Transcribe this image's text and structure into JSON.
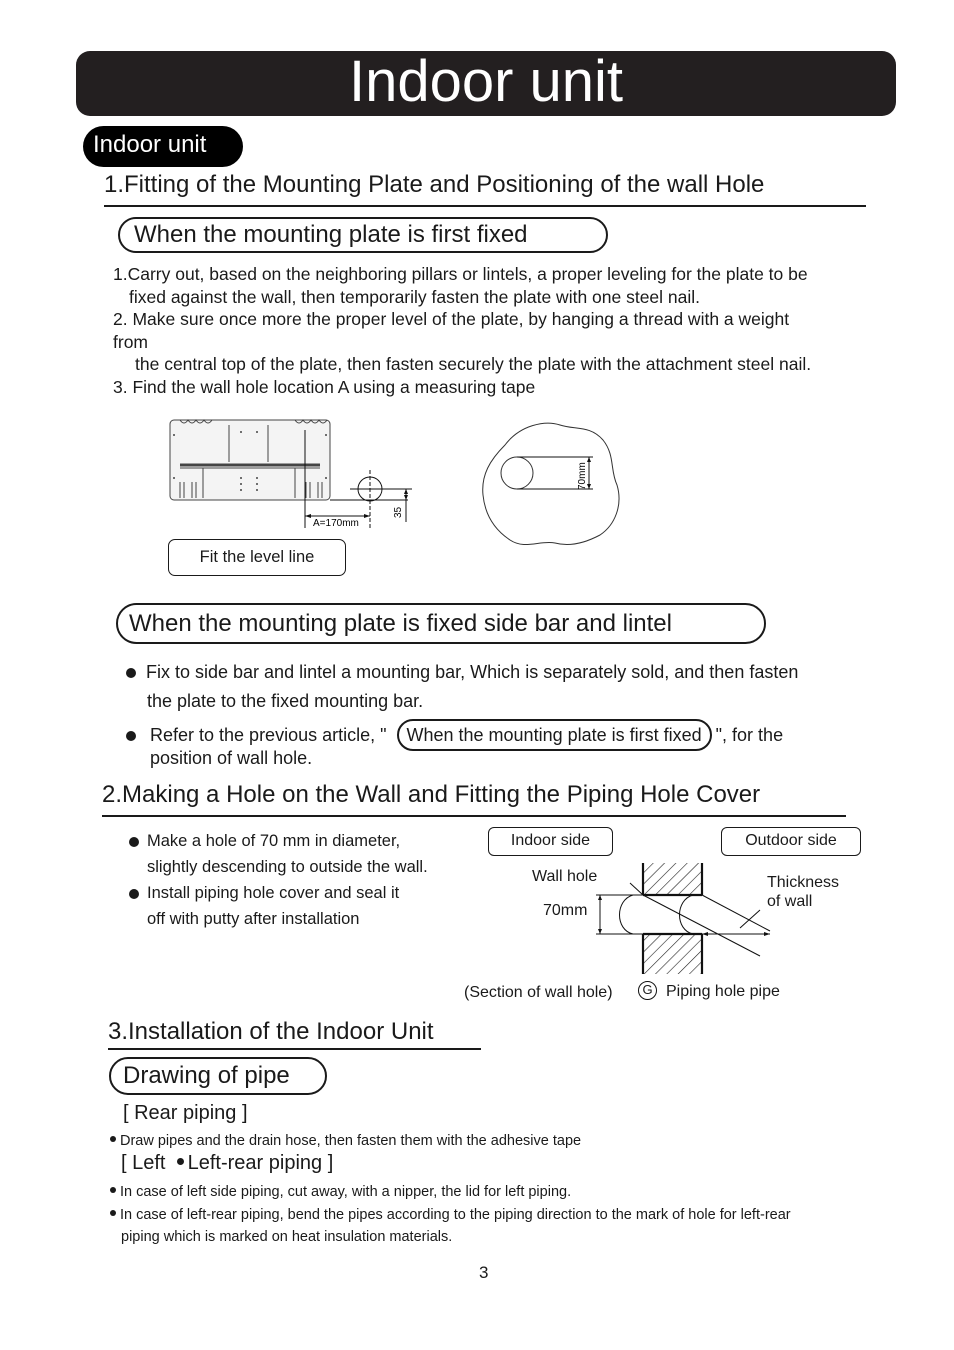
{
  "banner_title": "Indoor unit",
  "section_pill": "Indoor unit",
  "section1": {
    "heading": "1.Fitting of the Mounting Plate and Positioning of the wall Hole",
    "subsection_a": {
      "label": "When the mounting plate is first fixed",
      "steps": [
        "1.Carry out, based on the neighboring pillars or lintels, a proper leveling for the plate to be",
        "fixed against the wall, then temporarily fasten the plate with one steel nail.",
        "2. Make sure once more the proper level of the plate, by hanging a thread with a weight",
        "from",
        "the central top of the plate, then fasten securely the plate with the attachment steel nail.",
        "3. Find the wall hole location A using a measuring tape"
      ],
      "figure_plate": {
        "dimension_a": "A=170mm",
        "dimension_vertical": "35",
        "caption": "Fit the level line"
      },
      "figure_hole": {
        "diameter_label": "70mm"
      }
    },
    "subsection_b": {
      "label": "When the mounting plate is fixed side bar and lintel",
      "bullets": [
        {
          "lines": [
            "Fix to side bar and lintel a mounting bar, Which is separately sold, and then fasten",
            "the plate to the fixed mounting bar."
          ]
        },
        {
          "prefix": "Refer to the previous article, \"",
          "ref_pill": "When the mounting plate is first fixed",
          "suffix": "\", for the",
          "line2": "position of wall hole."
        }
      ]
    }
  },
  "section2": {
    "heading": "2.Making a Hole on the Wall and Fitting the Piping Hole Cover",
    "bullets": [
      [
        "Make a hole of 70 mm in diameter,",
        "slightly descending to outside the wall."
      ],
      [
        "Install piping hole cover and seal it",
        "off with putty after installation"
      ]
    ],
    "figure": {
      "indoor_label": "Indoor side",
      "outdoor_label": "Outdoor side",
      "wall_hole_label": "Wall hole",
      "diameter_label": "70mm",
      "thickness_label_1": "Thickness",
      "thickness_label_2": "of wall",
      "section_caption": "(Section of wall hole)",
      "part_letter": "G",
      "part_caption": "Piping hole pipe"
    }
  },
  "section3": {
    "heading": "3.Installation of the Indoor Unit",
    "pill": "Drawing of pipe",
    "rear_piping_title": "[ Rear piping ]",
    "rear_piping_items": [
      "Draw pipes and the drain hose, then fasten them with the adhesive tape"
    ],
    "left_piping_title_a": "[ Left",
    "left_piping_title_b": "Left-rear piping ]",
    "left_piping_items": [
      "In case of left side piping, cut away, with a nipper, the lid for left piping.",
      "In case of left-rear piping, bend the pipes according to the piping direction to the mark of hole for left-rear"
    ],
    "left_piping_continuation": "piping which is marked on heat insulation materials."
  },
  "page_number": "3"
}
